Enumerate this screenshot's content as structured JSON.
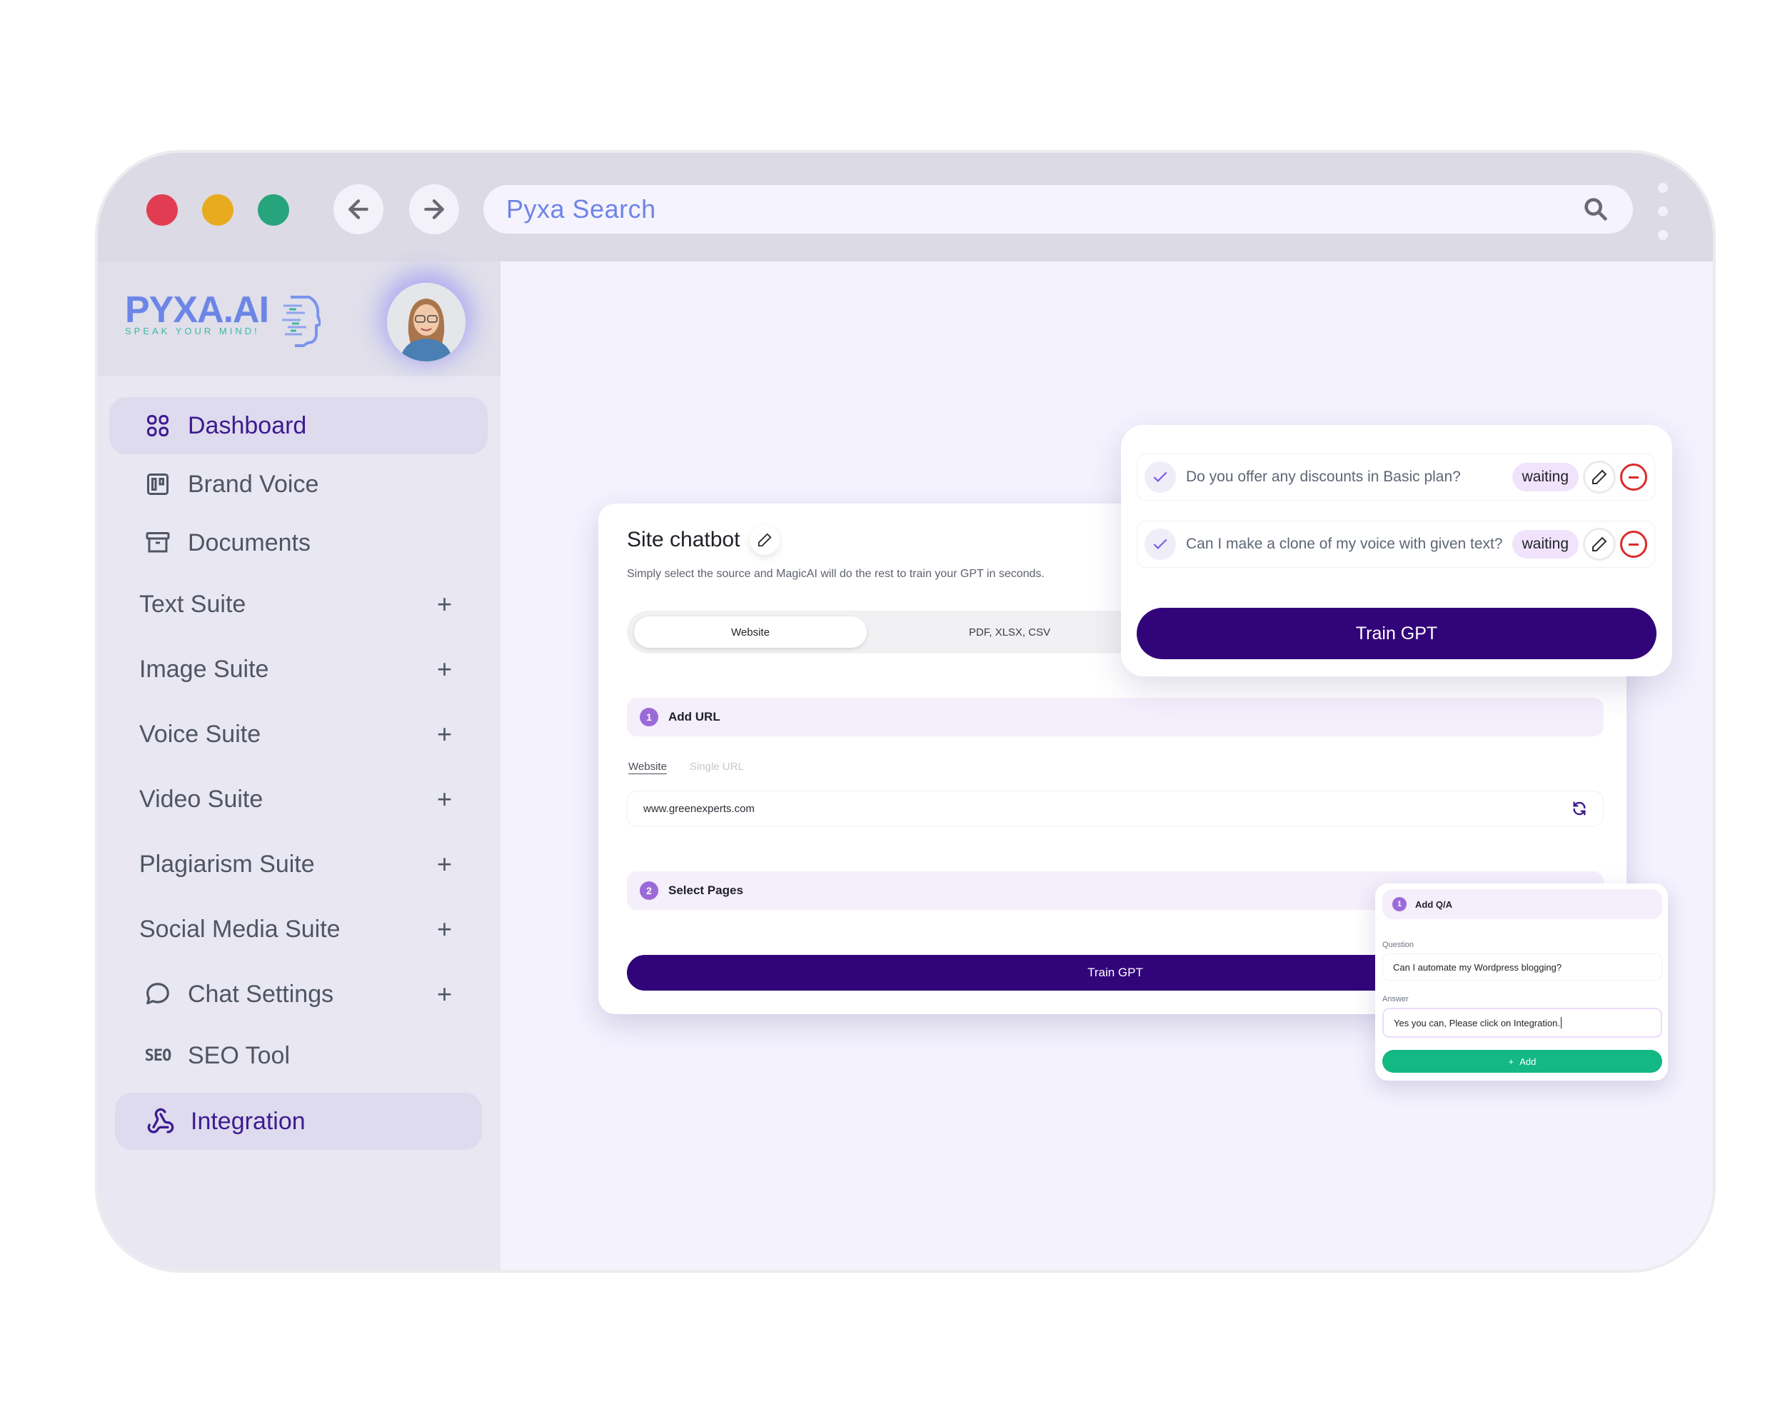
{
  "browser": {
    "search_placeholder": "Pyxa Search",
    "window_controls": [
      "close",
      "minimize",
      "maximize"
    ],
    "colors": {
      "close": "#e23c52",
      "minimize": "#e8ab1f",
      "maximize": "#26a47c"
    }
  },
  "sidebar": {
    "logo": {
      "brand": "PYXA.AI",
      "tagline": "SPEAK YOUR MIND!"
    },
    "items": [
      {
        "label": "Dashboard",
        "icon": "grid-icon",
        "active": true
      },
      {
        "label": "Brand Voice",
        "icon": "kanban-icon"
      },
      {
        "label": "Documents",
        "icon": "archive-icon"
      },
      {
        "label": "Text Suite",
        "expandable": true
      },
      {
        "label": "Image Suite",
        "expandable": true
      },
      {
        "label": "Voice Suite",
        "expandable": true
      },
      {
        "label": "Video Suite",
        "expandable": true
      },
      {
        "label": "Plagiarism Suite",
        "expandable": true
      },
      {
        "label": "Social Media Suite",
        "expandable": true
      },
      {
        "label": "Chat Settings",
        "icon": "chat-bubble-icon",
        "expandable": true
      },
      {
        "label": "SEO Tool",
        "icon": "seo-icon",
        "icon_text": "SEO"
      },
      {
        "label": "Integration",
        "icon": "webhook-icon",
        "active": true
      }
    ],
    "expand_symbol": "+"
  },
  "chatbot": {
    "title": "Site chatbot",
    "subtitle": "Simply select the source and MagicAI will do the rest to train your GPT in seconds.",
    "tabs": [
      {
        "label": "Website",
        "active": true
      },
      {
        "label": "PDF, XLSX, CSV",
        "active": false
      }
    ],
    "steps": [
      {
        "number": "1",
        "label": "Add URL"
      },
      {
        "number": "2",
        "label": "Select Pages"
      }
    ],
    "url_modes": [
      {
        "label": "Website",
        "active": true
      },
      {
        "label": "Single URL",
        "active": false
      }
    ],
    "url_value": "www.greenexperts.com",
    "train_button": "Train GPT"
  },
  "questions_panel": {
    "items": [
      {
        "text": "Do you offer any discounts in Basic plan?",
        "status": "waiting"
      },
      {
        "text": "Can I make a clone of my voice with given text?",
        "status": "waiting"
      }
    ],
    "train_button": "Train GPT"
  },
  "add_qa": {
    "step_number": "1",
    "title": "Add Q/A",
    "question_label": "Question",
    "question_value": "Can I automate my Wordpress blogging?",
    "answer_label": "Answer",
    "answer_value": "Yes you can, Please click on Integration.",
    "add_button": "Add"
  },
  "colors": {
    "primary": "#32047a",
    "accent_purple": "#9b6ad9",
    "success": "#13b883",
    "danger": "#dc2a2a",
    "brand_blue": "#6c86e6"
  }
}
